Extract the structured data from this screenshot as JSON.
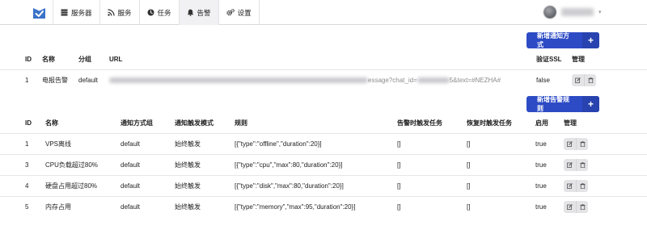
{
  "nav": {
    "items": [
      {
        "label": "服务器",
        "icon": "server-icon"
      },
      {
        "label": "服务",
        "icon": "rss-icon"
      },
      {
        "label": "任务",
        "icon": "clock-icon"
      },
      {
        "label": "告警",
        "icon": "bell-icon"
      },
      {
        "label": "设置",
        "icon": "cogs-icon"
      }
    ],
    "active": "告警"
  },
  "notifications": {
    "add_button_label": "新增通知方式",
    "headers": {
      "id": "ID",
      "name": "名称",
      "group": "分组",
      "url": "URL",
      "verify_ssl": "验证SSL",
      "manage": "管理"
    },
    "rows": [
      {
        "id": "1",
        "name": "电报告警",
        "group": "default",
        "url_visible_part": "essage?chat_id=",
        "url_visible_tail": "5&text=#NEZHA#",
        "verify_ssl": "false"
      }
    ]
  },
  "alert_rules": {
    "add_button_label": "新增告警规则",
    "headers": {
      "id": "ID",
      "name": "名称",
      "notification_group": "通知方式组",
      "trigger_mode": "通知触发模式",
      "rules": "规则",
      "fail_trigger_tasks": "告警时触发任务",
      "recover_trigger_tasks": "恢复时触发任务",
      "enabled": "启用",
      "manage": "管理"
    },
    "rows": [
      {
        "id": "1",
        "name": "VPS离线",
        "notification_group": "default",
        "trigger_mode": "始终触发",
        "rules": "[{\"type\":\"offline\",\"duration\":20}]",
        "fail_trigger_tasks": "[]",
        "recover_trigger_tasks": "[]",
        "enabled": "true"
      },
      {
        "id": "3",
        "name": "CPU负载超过80%",
        "notification_group": "default",
        "trigger_mode": "始终触发",
        "rules": "[{\"type\":\"cpu\",\"max\":80,\"duration\":20}]",
        "fail_trigger_tasks": "[]",
        "recover_trigger_tasks": "[]",
        "enabled": "true"
      },
      {
        "id": "4",
        "name": "硬盘占用超过80%",
        "notification_group": "default",
        "trigger_mode": "始终触发",
        "rules": "[{\"type\":\"disk\",\"max\":80,\"duration\":20}]",
        "fail_trigger_tasks": "[]",
        "recover_trigger_tasks": "[]",
        "enabled": "true"
      },
      {
        "id": "5",
        "name": "内存占用",
        "notification_group": "default",
        "trigger_mode": "始终触发",
        "rules": "[{\"type\":\"memory\",\"max\":95,\"duration\":20}]",
        "fail_trigger_tasks": "[]",
        "recover_trigger_tasks": "[]",
        "enabled": "true"
      }
    ]
  },
  "colors": {
    "primary": "#2d4bc5",
    "logo": "#3b73c9",
    "action_bg": "#e4e4e7"
  }
}
